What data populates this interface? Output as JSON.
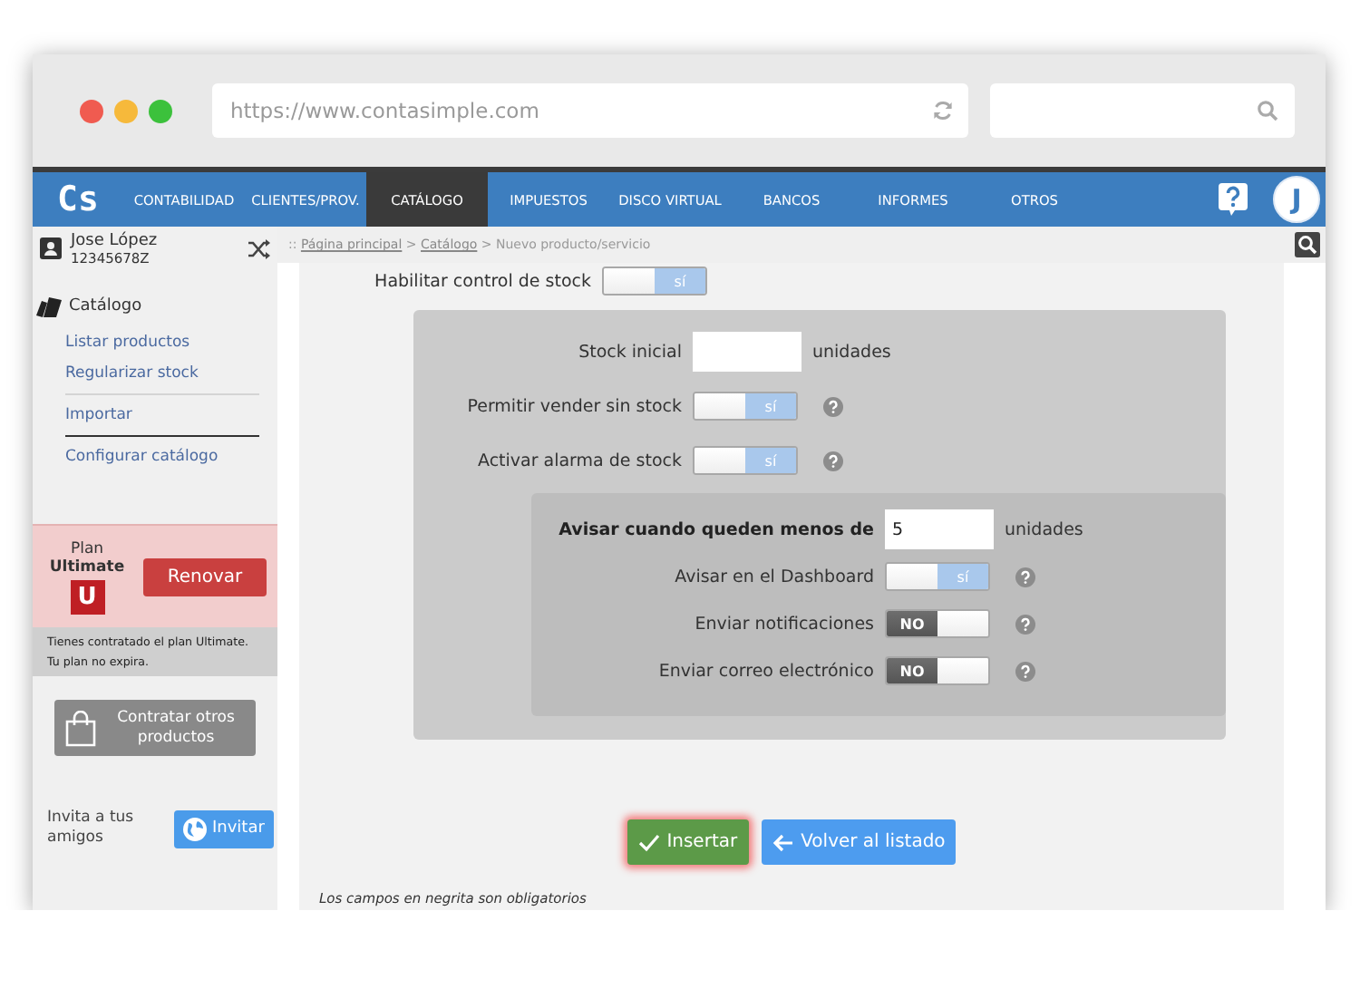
{
  "browser": {
    "url": "https://www.contasimple.com"
  },
  "nav": {
    "logo": "Cs",
    "avatar": "J",
    "items": [
      {
        "label": "CONTABILIDAD",
        "selected": false
      },
      {
        "label": "CLIENTES/PROV.",
        "selected": false
      },
      {
        "label": "CATÁLOGO",
        "selected": true
      },
      {
        "label": "IMPUESTOS",
        "selected": false
      },
      {
        "label": "DISCO VIRTUAL",
        "selected": false
      },
      {
        "label": "BANCOS",
        "selected": false
      },
      {
        "label": "INFORMES",
        "selected": false
      },
      {
        "label": "OTROS",
        "selected": false
      }
    ]
  },
  "sidebar": {
    "user": {
      "name": "Jose López",
      "id": "12345678Z"
    },
    "section": "Catálogo",
    "links": [
      {
        "kind": "link",
        "label": "Listar productos"
      },
      {
        "kind": "link",
        "label": "Regularizar stock"
      },
      {
        "kind": "divider",
        "color": "#d4d4d4"
      },
      {
        "kind": "link",
        "label": "Importar"
      },
      {
        "kind": "divider",
        "color": "#333333"
      },
      {
        "kind": "link",
        "label": "Configurar catálogo"
      }
    ],
    "plan": {
      "label": "Plan",
      "name": "Ultimate",
      "badge": "U",
      "button": "Renovar",
      "note": "Tienes contratado el plan Ultimate. Tu plan no expira."
    },
    "shop_button": "Contratar otros productos",
    "invite": {
      "text": "Invita a tus amigos",
      "button": "Invitar"
    }
  },
  "breadcrumb": [
    {
      "text": "::",
      "kind": "sep"
    },
    {
      "text": "Página principal",
      "kind": "link"
    },
    {
      "text": ">",
      "kind": "sep"
    },
    {
      "text": "Catálogo",
      "kind": "link"
    },
    {
      "text": ">",
      "kind": "sep"
    },
    {
      "text": "Nuevo producto/servicio",
      "kind": "current"
    }
  ],
  "form": {
    "stock_control": {
      "label": "Habilitar control de stock",
      "on": true,
      "text": "sí"
    },
    "stock_rows": [
      {
        "kind": "input",
        "label": "Stock inicial",
        "unit": "unidades"
      },
      {
        "kind": "toggle",
        "label": "Permitir vender sin stock",
        "on": true,
        "text": "sí",
        "help": true
      },
      {
        "kind": "toggle",
        "label": "Activar alarma de stock",
        "on": true,
        "text": "sí",
        "help": true
      }
    ],
    "alarm_rows": [
      {
        "kind": "input",
        "label": "Avisar cuando queden menos de",
        "value": "5",
        "unit": "unidades",
        "bold": true
      },
      {
        "kind": "toggle",
        "label": "Avisar en el Dashboard",
        "on": true,
        "text": "sí",
        "help": true
      },
      {
        "kind": "toggle",
        "label": "Enviar notificaciones",
        "on": false,
        "text": "NO",
        "help": true
      },
      {
        "kind": "toggle",
        "label": "Enviar correo electrónico",
        "on": false,
        "text": "NO",
        "help": true
      }
    ],
    "buttons": [
      {
        "kind": "primary",
        "label": "Insertar"
      },
      {
        "kind": "back",
        "label": "Volver al listado"
      }
    ],
    "footnote": "Los campos en negrita son obligatorios"
  }
}
